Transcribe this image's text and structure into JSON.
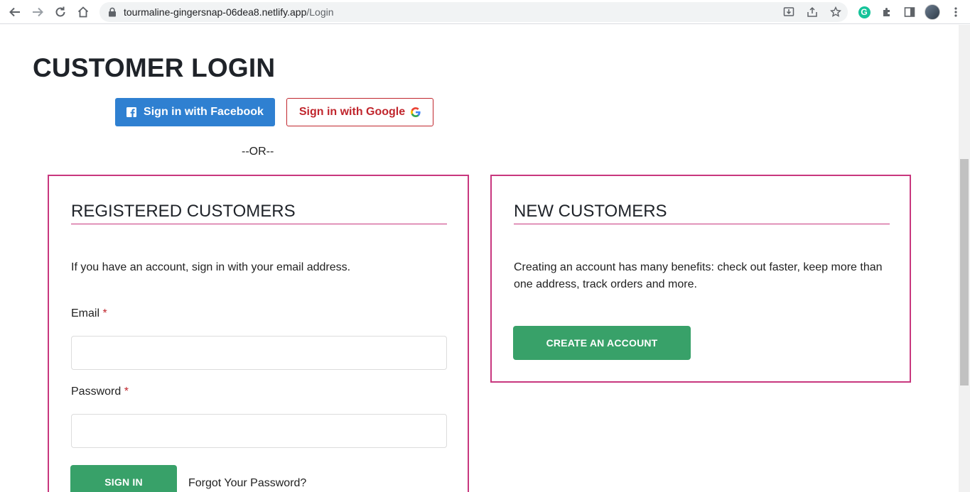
{
  "browser": {
    "url_host": "tourmaline-gingersnap-06dea8.netlify.app",
    "url_path": "/Login",
    "grammarly_letter": "G"
  },
  "page": {
    "title": "CUSTOMER LOGIN",
    "social": {
      "facebook_label": "Sign in with Facebook",
      "google_label": "Sign in with Google"
    },
    "or_text": "--OR--",
    "registered": {
      "heading": "REGISTERED CUSTOMERS",
      "intro": "If you have an account, sign in with your email address.",
      "email_label": "Email",
      "password_label": "Password",
      "required_mark": "*",
      "email_value": "",
      "password_value": "",
      "sign_in_label": "SIGN IN",
      "forgot_label": "Forgot Your Password?"
    },
    "new_customers": {
      "heading": "NEW CUSTOMERS",
      "intro": "Creating an account has many benefits: check out faster, keep more than one address, track orders and more.",
      "create_label": "CREATE AN ACCOUNT"
    }
  },
  "colors": {
    "facebook_blue": "#2f80d1",
    "google_red": "#c0262d",
    "box_border": "#c8377e",
    "action_green": "#38a169"
  }
}
